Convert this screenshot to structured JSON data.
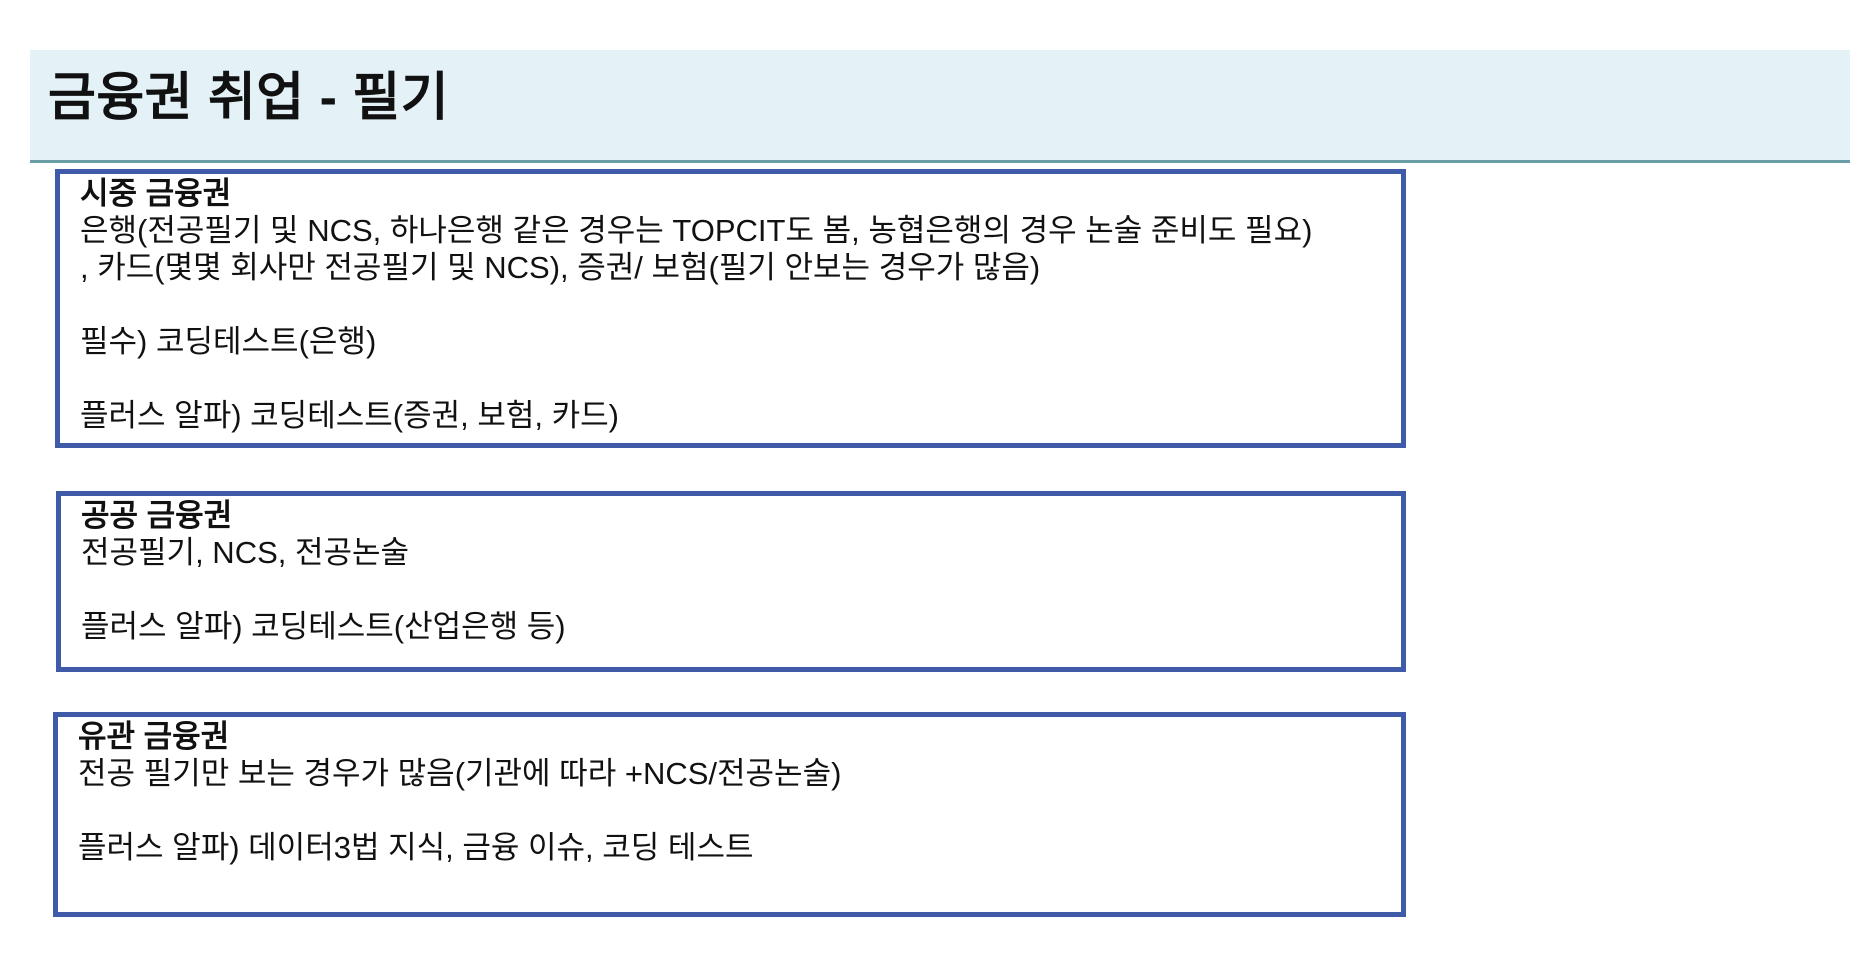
{
  "header": {
    "title": "금융권 취업 - 필기"
  },
  "sections": [
    {
      "title": "시중 금융권",
      "lines": [
        "은행(전공필기 및 NCS, 하나은행 같은 경우는 TOPCIT도 봄, 농협은행의 경우 논술 준비도 필요)",
        ", 카드(몇몇 회사만 전공필기 및 NCS), 증권/ 보험(필기 안보는 경우가 많음)",
        "필수) 코딩테스트(은행)",
        "플러스 알파) 코딩테스트(증권, 보험, 카드)"
      ]
    },
    {
      "title": "공공 금융권",
      "lines": [
        "전공필기, NCS, 전공논술",
        "플러스 알파) 코딩테스트(산업은행 등)"
      ]
    },
    {
      "title": "유관 금융권",
      "lines": [
        "전공 필기만 보는 경우가 많음(기관에 따라 +NCS/전공논술)",
        "플러스 알파) 데이터3법 지식, 금융 이슈, 코딩 테스트"
      ]
    }
  ],
  "colors": {
    "header_background": "#e4f2f7",
    "header_rule": "#6a9ea6",
    "box_border": "#3f5aa8",
    "text": "#111111"
  }
}
